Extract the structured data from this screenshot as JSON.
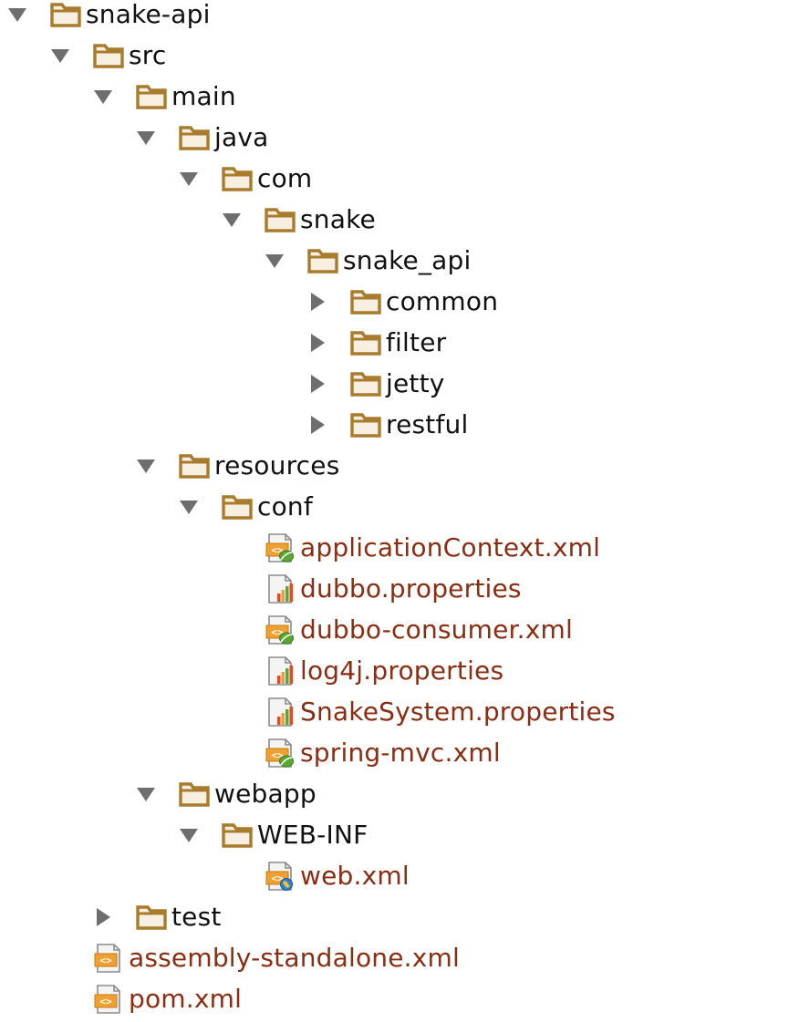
{
  "colors": {
    "folder_outline": "#a97b2c",
    "folder_fill": "#f6efe2",
    "arrow": "#6e6e6e",
    "file_text": "#8a2d12",
    "folder_text": "#111111"
  },
  "tree": [
    {
      "label": "snake-api",
      "depth": 0,
      "type": "folder",
      "state": "expanded",
      "icon": "folder-icon"
    },
    {
      "label": "src",
      "depth": 1,
      "type": "folder",
      "state": "expanded",
      "icon": "folder-icon"
    },
    {
      "label": "main",
      "depth": 2,
      "type": "folder",
      "state": "expanded",
      "icon": "folder-icon"
    },
    {
      "label": "java",
      "depth": 3,
      "type": "folder",
      "state": "expanded",
      "icon": "folder-icon"
    },
    {
      "label": "com",
      "depth": 4,
      "type": "folder",
      "state": "expanded",
      "icon": "folder-icon"
    },
    {
      "label": "snake",
      "depth": 5,
      "type": "folder",
      "state": "expanded",
      "icon": "folder-icon"
    },
    {
      "label": "snake_api",
      "depth": 6,
      "type": "folder",
      "state": "expanded",
      "icon": "folder-icon"
    },
    {
      "label": "common",
      "depth": 7,
      "type": "folder",
      "state": "collapsed",
      "icon": "folder-icon"
    },
    {
      "label": "filter",
      "depth": 7,
      "type": "folder",
      "state": "collapsed",
      "icon": "folder-icon"
    },
    {
      "label": "jetty",
      "depth": 7,
      "type": "folder",
      "state": "collapsed",
      "icon": "folder-icon"
    },
    {
      "label": "restful",
      "depth": 7,
      "type": "folder",
      "state": "collapsed",
      "icon": "folder-icon"
    },
    {
      "label": "resources",
      "depth": 3,
      "type": "folder",
      "state": "expanded",
      "icon": "folder-icon"
    },
    {
      "label": "conf",
      "depth": 4,
      "type": "folder",
      "state": "expanded",
      "icon": "folder-icon"
    },
    {
      "label": "applicationContext.xml",
      "depth": 5,
      "type": "file",
      "state": "none",
      "icon": "spring-xml-icon"
    },
    {
      "label": "dubbo.properties",
      "depth": 5,
      "type": "file",
      "state": "none",
      "icon": "properties-icon"
    },
    {
      "label": "dubbo-consumer.xml",
      "depth": 5,
      "type": "file",
      "state": "none",
      "icon": "spring-xml-icon"
    },
    {
      "label": "log4j.properties",
      "depth": 5,
      "type": "file",
      "state": "none",
      "icon": "properties-icon"
    },
    {
      "label": "SnakeSystem.properties",
      "depth": 5,
      "type": "file",
      "state": "none",
      "icon": "properties-icon"
    },
    {
      "label": "spring-mvc.xml",
      "depth": 5,
      "type": "file",
      "state": "none",
      "icon": "spring-xml-icon"
    },
    {
      "label": "webapp",
      "depth": 3,
      "type": "folder",
      "state": "expanded",
      "icon": "folder-icon"
    },
    {
      "label": "WEB-INF",
      "depth": 4,
      "type": "folder",
      "state": "expanded",
      "icon": "folder-icon"
    },
    {
      "label": "web.xml",
      "depth": 5,
      "type": "file",
      "state": "none",
      "icon": "web-xml-icon"
    },
    {
      "label": "test",
      "depth": 2,
      "type": "folder",
      "state": "collapsed",
      "icon": "folder-icon"
    },
    {
      "label": "assembly-standalone.xml",
      "depth": 1,
      "type": "file",
      "state": "none",
      "icon": "xml-file-icon"
    },
    {
      "label": "pom.xml",
      "depth": 1,
      "type": "file",
      "state": "none",
      "icon": "xml-file-icon"
    }
  ]
}
